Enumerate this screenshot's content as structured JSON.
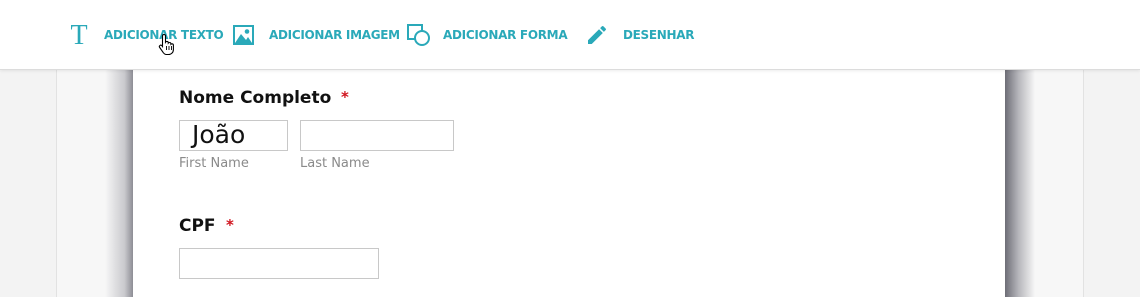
{
  "toolbar": {
    "add_text_label": "ADICIONAR TEXTO",
    "add_image_label": "ADICIONAR IMAGEM",
    "add_shape_label": "ADICIONAR FORMA",
    "draw_label": "DESENHAR",
    "accent_color": "#2aa9b9"
  },
  "form": {
    "full_name": {
      "label": "Nome Completo",
      "required_mark": "*",
      "first_name_value": "João",
      "first_name_sublabel": "First Name",
      "last_name_value": "",
      "last_name_sublabel": "Last Name"
    },
    "cpf": {
      "label": "CPF",
      "required_mark": "*",
      "value": ""
    },
    "required_color": "#d0141e"
  },
  "icons": [
    "text-icon",
    "image-icon",
    "shape-icon",
    "pencil-icon",
    "hand-cursor-icon"
  ]
}
